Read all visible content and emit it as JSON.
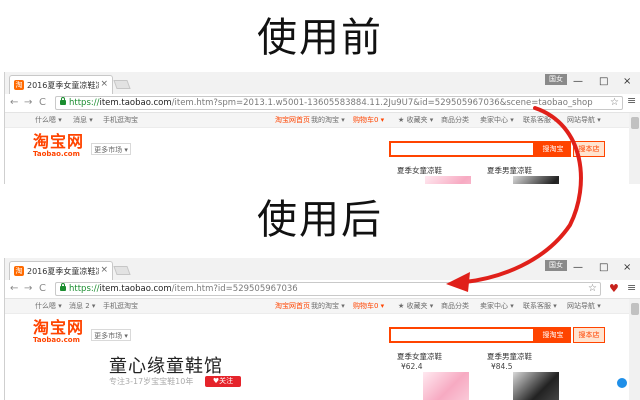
{
  "headings": {
    "before": "使用前",
    "after": "使用后"
  },
  "browser_before": {
    "tab_title": "2016夏季女童凉鞋凉鞋儿",
    "tab_close": "×",
    "user_badge": "国女",
    "window": {
      "minimize": "—",
      "maximize": "□",
      "close": "×"
    },
    "nav": {
      "back": "←",
      "forward": "→",
      "reload": "C"
    },
    "url_scheme": "https://",
    "url_host": "item.taobao.com",
    "url_path": "/item.htm?spm=2013.1.w5001-13605583884.11.2Ju9U7&id=529505967036&scene=taobao_shop",
    "star": "☆",
    "menu": "≡"
  },
  "browser_after": {
    "tab_title": "2016夏季女童凉鞋凉鞋儿",
    "tab_close": "×",
    "user_badge": "国女",
    "window": {
      "minimize": "—",
      "maximize": "□",
      "close": "×"
    },
    "nav": {
      "back": "←",
      "forward": "→",
      "reload": "C"
    },
    "url_scheme": "https://",
    "url_host": "item.taobao.com",
    "url_path": "/item.htm?id=529505967036",
    "star": "☆",
    "ext_icon": "♥",
    "menu": "≡"
  },
  "topnav_before": {
    "user": "什么嗯 ▾",
    "messages": "消息 ▾",
    "mobile": "手机逛淘宝",
    "home": "淘宝网首页",
    "my_taobao": "我的淘宝 ▾",
    "cart": "购物车0 ▾",
    "favorites": "★ 收藏夹 ▾",
    "categories": "商品分类",
    "seller": "卖家中心 ▾",
    "service": "联系客服 ▾",
    "sitemap": "网站导航 ▾"
  },
  "topnav_after": {
    "user": "什么嗯 ▾",
    "messages": "消息 2 ▾",
    "mobile": "手机逛淘宝",
    "home": "淘宝网首页",
    "my_taobao": "我的淘宝 ▾",
    "cart": "购物车0 ▾",
    "favorites": "★ 收藏夹 ▾",
    "categories": "商品分类",
    "seller": "卖家中心 ▾",
    "service": "联系客服 ▾",
    "sitemap": "网站导航 ▾"
  },
  "page": {
    "logo_cn": "淘宝网",
    "logo_en": "Taobao.com",
    "more_market": "更多市场 ▾",
    "search_button": "搜淘宝",
    "store_button": "搜本店",
    "shop_name": "童心缘童鞋馆",
    "shop_sub": "专注3-17岁宝宝鞋10年",
    "follow": "♥关注",
    "products": [
      {
        "name": "夏季女童凉鞋",
        "price": "¥62.4"
      },
      {
        "name": "夏季男童凉鞋",
        "price": "¥84.5"
      }
    ]
  },
  "colors": {
    "taobao_orange": "#ff4400",
    "arrow_red": "#e0201a",
    "secure_green": "#1a8d2f"
  }
}
